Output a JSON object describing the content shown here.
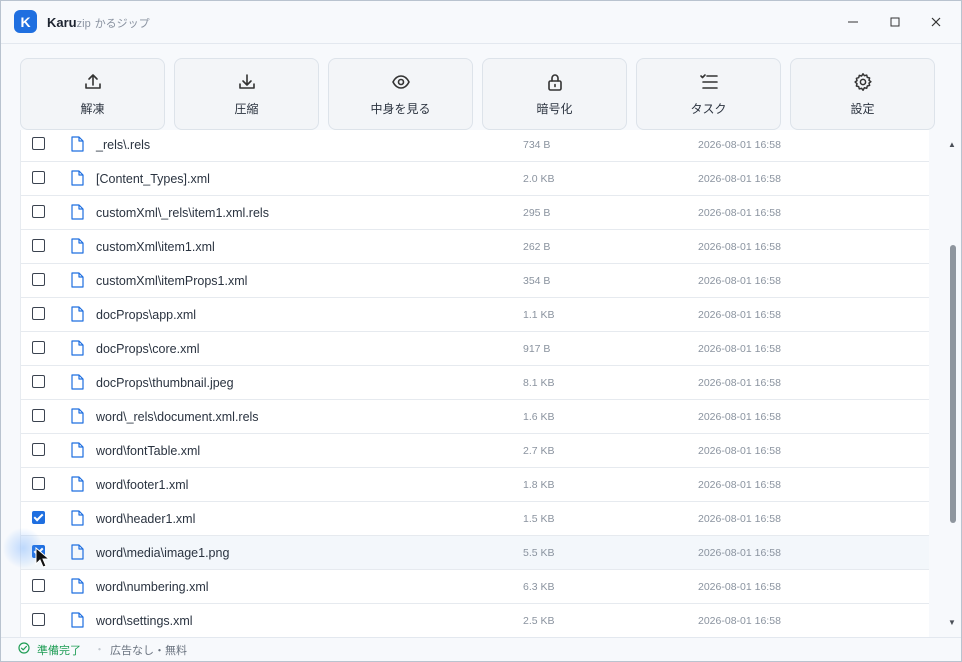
{
  "app": {
    "logo_letter": "K",
    "brand": "Karu",
    "brand_suffix": "zip",
    "subtitle": "かるジップ"
  },
  "window_controls": {
    "minimize": "–",
    "maximize": "☐",
    "close": "✕"
  },
  "toolbar": [
    {
      "label": "解凍",
      "icon": "upload-icon"
    },
    {
      "label": "圧縮",
      "icon": "download-icon"
    },
    {
      "label": "中身を見る",
      "icon": "eye-icon"
    },
    {
      "label": "暗号化",
      "icon": "lock-icon"
    },
    {
      "label": "タスク",
      "icon": "task-list-icon"
    },
    {
      "label": "設定",
      "icon": "gear-icon"
    }
  ],
  "files": [
    {
      "name": "_rels\\.rels",
      "size": "734 B",
      "date": "2026-08-01 16:58",
      "checked": false
    },
    {
      "name": "[Content_Types].xml",
      "size": "2.0 KB",
      "date": "2026-08-01 16:58",
      "checked": false
    },
    {
      "name": "customXml\\_rels\\item1.xml.rels",
      "size": "295 B",
      "date": "2026-08-01 16:58",
      "checked": false
    },
    {
      "name": "customXml\\item1.xml",
      "size": "262 B",
      "date": "2026-08-01 16:58",
      "checked": false
    },
    {
      "name": "customXml\\itemProps1.xml",
      "size": "354 B",
      "date": "2026-08-01 16:58",
      "checked": false
    },
    {
      "name": "docProps\\app.xml",
      "size": "1.1 KB",
      "date": "2026-08-01 16:58",
      "checked": false
    },
    {
      "name": "docProps\\core.xml",
      "size": "917 B",
      "date": "2026-08-01 16:58",
      "checked": false
    },
    {
      "name": "docProps\\thumbnail.jpeg",
      "size": "8.1 KB",
      "date": "2026-08-01 16:58",
      "checked": false
    },
    {
      "name": "word\\_rels\\document.xml.rels",
      "size": "1.6 KB",
      "date": "2026-08-01 16:58",
      "checked": false
    },
    {
      "name": "word\\fontTable.xml",
      "size": "2.7 KB",
      "date": "2026-08-01 16:58",
      "checked": false
    },
    {
      "name": "word\\footer1.xml",
      "size": "1.8 KB",
      "date": "2026-08-01 16:58",
      "checked": false
    },
    {
      "name": "word\\header1.xml",
      "size": "1.5 KB",
      "date": "2026-08-01 16:58",
      "checked": true
    },
    {
      "name": "word\\media\\image1.png",
      "size": "5.5 KB",
      "date": "2026-08-01 16:58",
      "checked": true
    },
    {
      "name": "word\\numbering.xml",
      "size": "6.3 KB",
      "date": "2026-08-01 16:58",
      "checked": false
    },
    {
      "name": "word\\settings.xml",
      "size": "2.5 KB",
      "date": "2026-08-01 16:58",
      "checked": false
    }
  ],
  "hovered_row": 12,
  "status": {
    "state": "準備完了",
    "separator": "・",
    "note": "広告なし・無料"
  },
  "colors": {
    "accent": "#1f6fe0",
    "status_ok": "#1f9d55"
  }
}
